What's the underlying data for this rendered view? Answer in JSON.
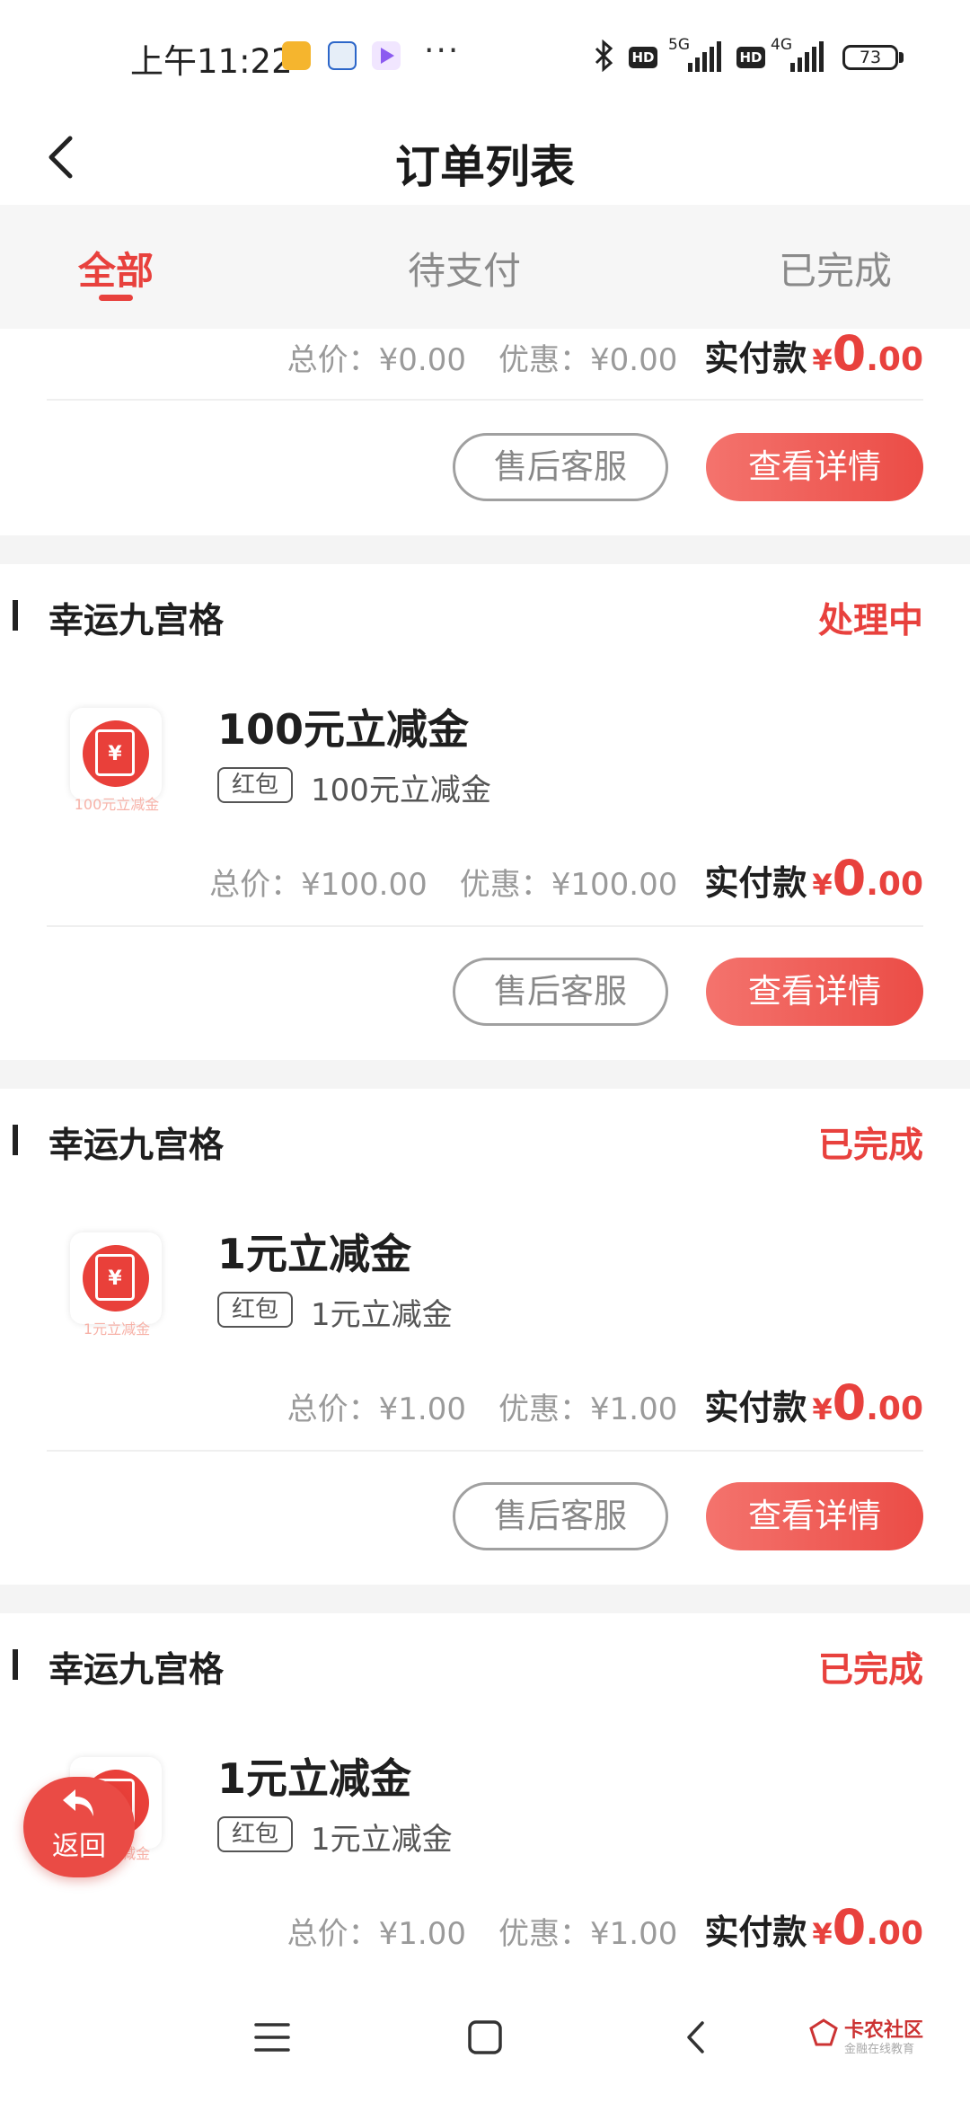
{
  "status_bar": {
    "time": "上午11:22",
    "network_1": "5G",
    "network_2": "4G",
    "hd_badge": "HD",
    "battery": "73",
    "more": "···"
  },
  "header": {
    "title": "订单列表"
  },
  "tabs": [
    {
      "label": "全部",
      "active": true
    },
    {
      "label": "待支付",
      "active": false
    },
    {
      "label": "已完成",
      "active": false
    }
  ],
  "labels": {
    "total": "总价：",
    "discount": "优惠：",
    "paid": "实付款",
    "yen": "¥",
    "after_sales": "售后客服",
    "view_detail": "查看详情",
    "tag": "红包",
    "return": "返回"
  },
  "orders": [
    {
      "shop": "",
      "status": "",
      "title": "",
      "thumb_caption": "",
      "subtitle": "",
      "total": "¥0.00",
      "discount": "¥0.00",
      "paid_int": "0",
      "paid_dec": ".00"
    },
    {
      "shop": "幸运九宫格",
      "status": "处理中",
      "title": "100元立减金",
      "thumb_caption": "100元立减金",
      "subtitle": "100元立减金",
      "total": "¥100.00",
      "discount": "¥100.00",
      "paid_int": "0",
      "paid_dec": ".00"
    },
    {
      "shop": "幸运九宫格",
      "status": "已完成",
      "title": "1元立减金",
      "thumb_caption": "1元立减金",
      "subtitle": "1元立减金",
      "total": "¥1.00",
      "discount": "¥1.00",
      "paid_int": "0",
      "paid_dec": ".00"
    },
    {
      "shop": "幸运九宫格",
      "status": "已完成",
      "title": "1元立减金",
      "thumb_caption": "1元立减金",
      "subtitle": "1元立减金",
      "total": "¥1.00",
      "discount": "¥1.00",
      "paid_int": "0",
      "paid_dec": ".00"
    }
  ],
  "watermark": {
    "name": "卡农社区",
    "slogan": "金融在线教育"
  },
  "colors": {
    "accent": "#e8413d",
    "page_bg": "#f4f4f4",
    "tab_bg": "#f6f6f6"
  }
}
